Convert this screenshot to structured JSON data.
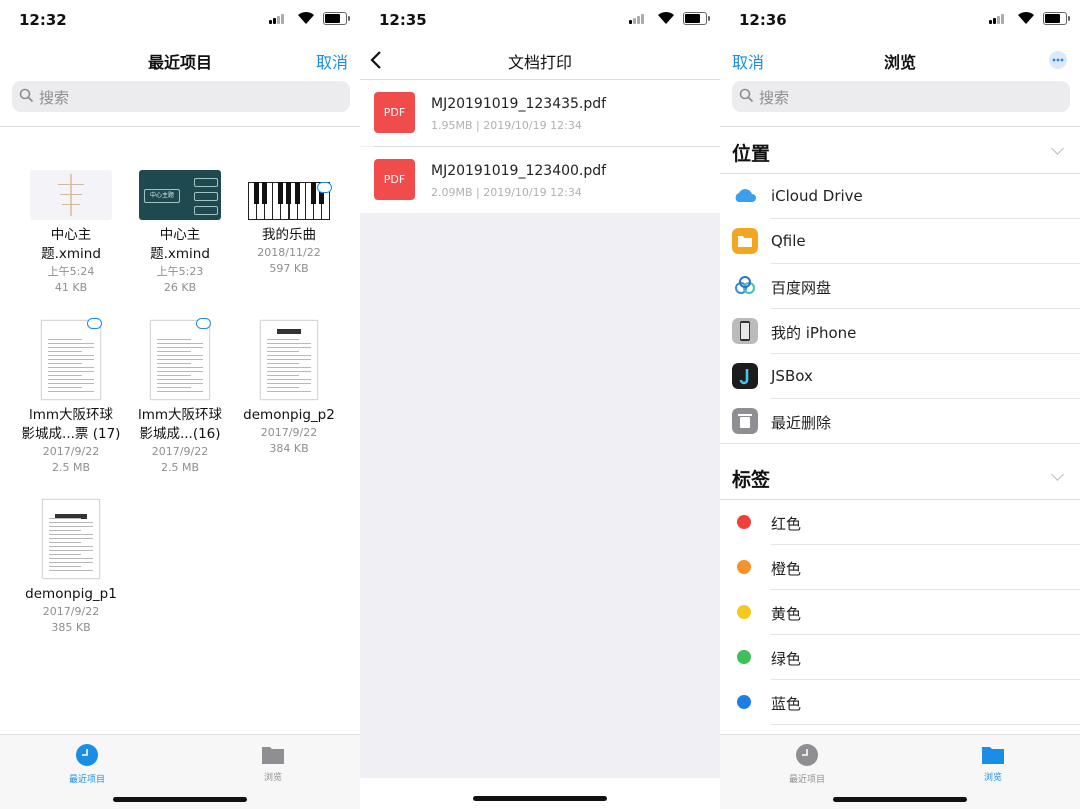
{
  "panel1": {
    "status": {
      "time": "12:32"
    },
    "title": "最近项目",
    "cancel": "取消",
    "search_placeholder": "搜索",
    "files": [
      {
        "name_l1": "中心主",
        "name_l2": "题.xmind",
        "date": "上午5:24",
        "size": "41 KB"
      },
      {
        "name_l1": "中心主",
        "name_l2": "题.xmind",
        "date": "上午5:23",
        "size": "26 KB",
        "thumb_text": "中心主题"
      },
      {
        "name_l1": "我的乐曲",
        "name_l2": "",
        "date": "2018/11/22",
        "size": "597 KB"
      },
      {
        "name_l1": "lmm大阪环球",
        "name_l2": "影城成...票 (17)",
        "date": "2017/9/22",
        "size": "2.5 MB"
      },
      {
        "name_l1": "lmm大阪环球",
        "name_l2": "影城成...(16)",
        "date": "2017/9/22",
        "size": "2.5 MB"
      },
      {
        "name_l1": "demonpig_p2",
        "name_l2": "",
        "date": "2017/9/22",
        "size": "384 KB"
      },
      {
        "name_l1": "demonpig_p1",
        "name_l2": "",
        "date": "2017/9/22",
        "size": "385 KB"
      }
    ],
    "tabs": [
      {
        "label": "最近项目",
        "active": true
      },
      {
        "label": "浏览",
        "active": false
      }
    ],
    "accent": "#1a8ee6"
  },
  "panel2": {
    "status": {
      "time": "12:35"
    },
    "title": "文档打印",
    "files": [
      {
        "icon_label": "PDF",
        "name": "MJ20191019_123435.pdf",
        "meta": "1.95MB | 2019/10/19 12:34"
      },
      {
        "icon_label": "PDF",
        "name": "MJ20191019_123400.pdf",
        "meta": "2.09MB | 2019/10/19 12:34"
      }
    ],
    "pdf_color": "#f14c4c"
  },
  "panel3": {
    "status": {
      "time": "12:36"
    },
    "title": "浏览",
    "cancel": "取消",
    "search_placeholder": "搜索",
    "locations_header": "位置",
    "locations": [
      {
        "label": "iCloud Drive",
        "icon": "icloud-icon"
      },
      {
        "label": "Qfile",
        "icon": "qfile-folder-icon"
      },
      {
        "label": "百度网盘",
        "icon": "baidu-netdisk-icon"
      },
      {
        "label": "我的 iPhone",
        "icon": "iphone-icon"
      },
      {
        "label": "JSBox",
        "icon": "jsbox-icon"
      },
      {
        "label": "最近删除",
        "icon": "trash-icon"
      }
    ],
    "tags_header": "标签",
    "tags": [
      {
        "label": "红色",
        "color": "#f0403c"
      },
      {
        "label": "橙色",
        "color": "#f5922a"
      },
      {
        "label": "黄色",
        "color": "#f7c81f"
      },
      {
        "label": "绿色",
        "color": "#3fbf5a"
      },
      {
        "label": "蓝色",
        "color": "#1d7fe6"
      }
    ],
    "tabs": [
      {
        "label": "最近项目",
        "active": false
      },
      {
        "label": "浏览",
        "active": true
      }
    ]
  }
}
